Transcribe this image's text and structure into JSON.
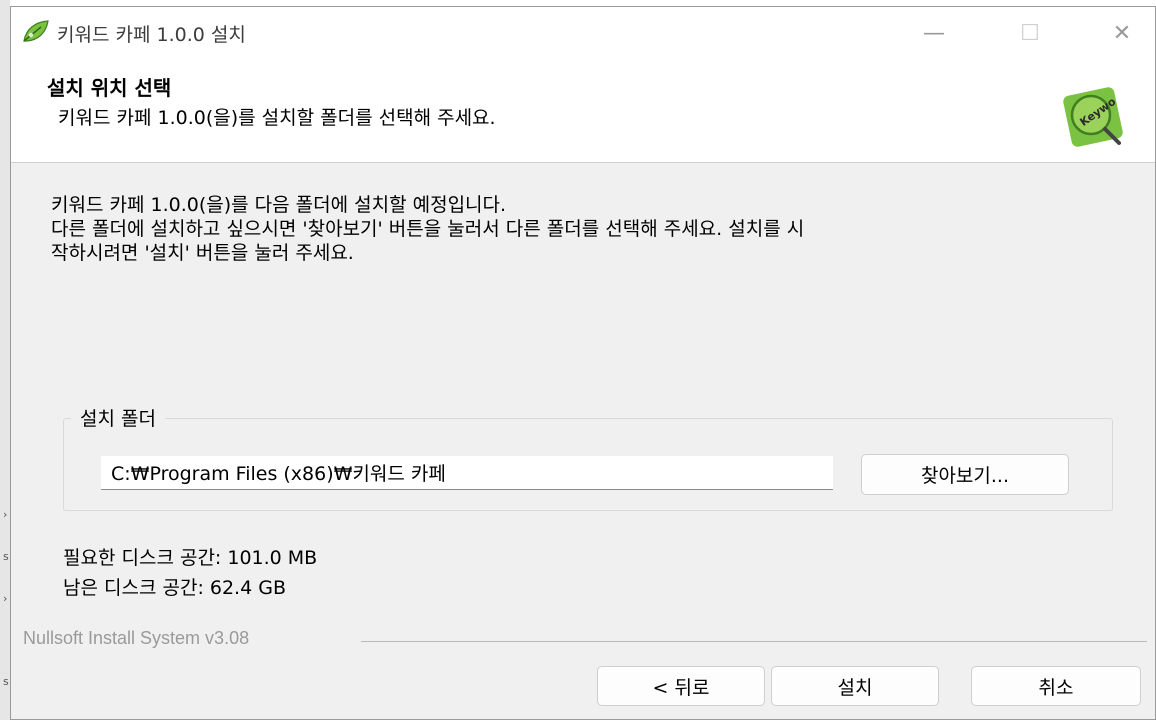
{
  "window": {
    "title": "키워드 카페 1.0.0 설치",
    "controls": {
      "minimize": "—",
      "maximize": "☐",
      "close": "✕"
    }
  },
  "header": {
    "title": "설치 위치 선택",
    "subtitle": "키워드 카페 1.0.0(을)를 설치할 폴더를 선택해 주세요.",
    "logo_text": "Keywo"
  },
  "description": {
    "line1": "키워드 카페 1.0.0(을)를 다음 폴더에 설치할 예정입니다.",
    "line2": "다른 폴더에 설치하고 싶으시면 '찾아보기' 버튼을 눌러서 다른 폴더를 선택해 주세요. 설치를 시",
    "line3": "작하시려면 '설치' 버튼을 눌러 주세요."
  },
  "install_folder": {
    "group_label": "설치 폴더",
    "path": "C:₩Program Files (x86)₩키워드 카페",
    "browse_label": "찾아보기..."
  },
  "disk": {
    "required": "필요한 디스크 공간: 101.0 MB",
    "available": "남은 디스크 공간: 62.4 GB"
  },
  "footer": {
    "nsis_label": "Nullsoft Install System v3.08",
    "back_label": "< 뒤로",
    "install_label": "설치",
    "cancel_label": "취소"
  },
  "colors": {
    "window_bg": "#f0f0f0",
    "header_bg": "#ffffff",
    "logo_green": "#7cc242",
    "disabled_text": "#9a9a9a"
  },
  "icons": [
    "app-leaf-icon",
    "keyword-logo-icon",
    "minimize-icon",
    "maximize-icon",
    "close-icon"
  ]
}
